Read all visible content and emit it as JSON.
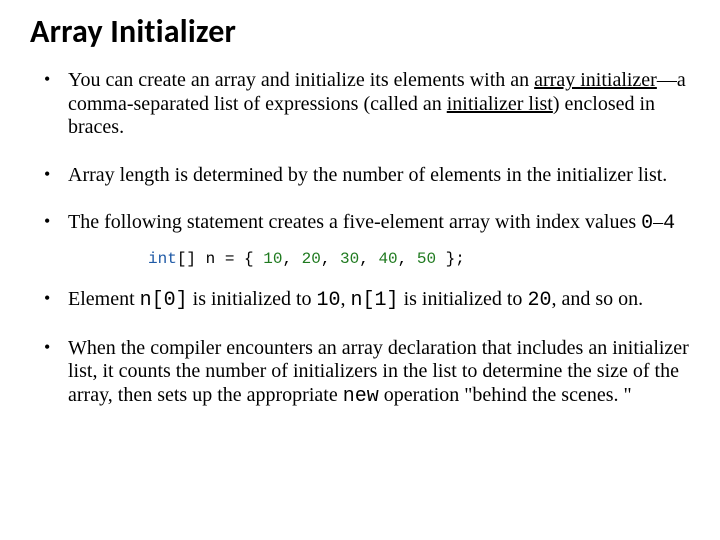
{
  "title": "Array Initializer",
  "bullets": {
    "b1_pre": "You can create an array and initialize its elements with an ",
    "b1_u1": "array initializer",
    "b1_mid": "—a comma-separated list of expressions (called an ",
    "b1_u2": "initializer list",
    "b1_post": ") enclosed in braces.",
    "b2": "Array length is determined by the number of elements in the initializer list.",
    "b3_pre": "The following statement creates a five-element array with index values ",
    "b3_r1": "0",
    "b3_dash": "–",
    "b3_r2": "4",
    "b4_a": "Element ",
    "b4_c1": "n[0]",
    "b4_b": " is initialized to ",
    "b4_v1": "10",
    "b4_c": ", ",
    "b4_c2": "n[1]",
    "b4_d": " is initialized to ",
    "b4_v2": "20",
    "b4_e": ", and so on.",
    "b5_a": "When the compiler encounters an array declaration that includes an initializer list, it counts the number of initializers in the list to determine the size of the array, then sets up the appropriate ",
    "b5_kw": "new",
    "b5_b": " operation \"behind the scenes. \""
  },
  "code": {
    "kw": "int",
    "brackets": "[] ",
    "var": "n = { ",
    "n1": "10",
    "n2": "20",
    "n3": "30",
    "n4": "40",
    "n5": "50",
    "sep": ", ",
    "end": " };"
  }
}
